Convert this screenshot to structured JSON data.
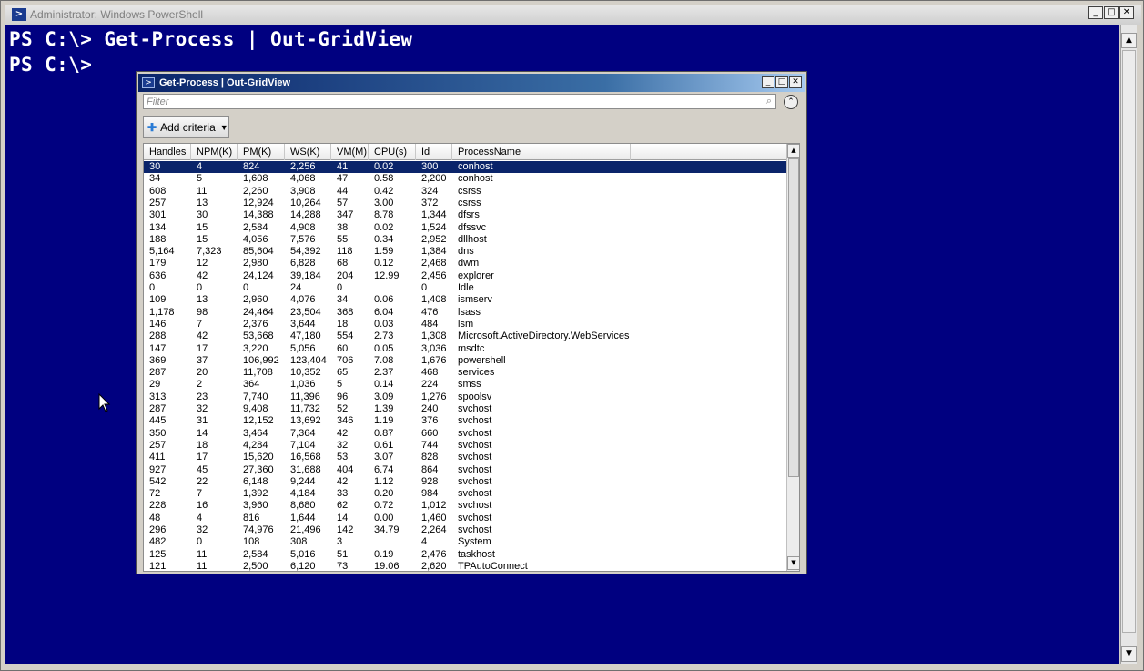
{
  "ps_window": {
    "title": "Administrator: Windows PowerShell",
    "console_lines": [
      "PS C:\\> Get-Process | Out-GridView",
      "PS C:\\>"
    ]
  },
  "gridview": {
    "title": "Get-Process | Out-GridView",
    "filter_placeholder": "Filter",
    "add_criteria_label": "Add criteria",
    "columns": [
      "Handles",
      "NPM(K)",
      "PM(K)",
      "WS(K)",
      "VM(M)",
      "CPU(s)",
      "Id",
      "ProcessName"
    ],
    "rows": [
      [
        "30",
        "4",
        "824",
        "2,256",
        "41",
        "0.02",
        "300",
        "conhost"
      ],
      [
        "34",
        "5",
        "1,608",
        "4,068",
        "47",
        "0.58",
        "2,200",
        "conhost"
      ],
      [
        "608",
        "11",
        "2,260",
        "3,908",
        "44",
        "0.42",
        "324",
        "csrss"
      ],
      [
        "257",
        "13",
        "12,924",
        "10,264",
        "57",
        "3.00",
        "372",
        "csrss"
      ],
      [
        "301",
        "30",
        "14,388",
        "14,288",
        "347",
        "8.78",
        "1,344",
        "dfsrs"
      ],
      [
        "134",
        "15",
        "2,584",
        "4,908",
        "38",
        "0.02",
        "1,524",
        "dfssvc"
      ],
      [
        "188",
        "15",
        "4,056",
        "7,576",
        "55",
        "0.34",
        "2,952",
        "dllhost"
      ],
      [
        "5,164",
        "7,323",
        "85,604",
        "54,392",
        "118",
        "1.59",
        "1,384",
        "dns"
      ],
      [
        "179",
        "12",
        "2,980",
        "6,828",
        "68",
        "0.12",
        "2,468",
        "dwm"
      ],
      [
        "636",
        "42",
        "24,124",
        "39,184",
        "204",
        "12.99",
        "2,456",
        "explorer"
      ],
      [
        "0",
        "0",
        "0",
        "24",
        "0",
        "",
        "0",
        "Idle"
      ],
      [
        "109",
        "13",
        "2,960",
        "4,076",
        "34",
        "0.06",
        "1,408",
        "ismserv"
      ],
      [
        "1,178",
        "98",
        "24,464",
        "23,504",
        "368",
        "6.04",
        "476",
        "lsass"
      ],
      [
        "146",
        "7",
        "2,376",
        "3,644",
        "18",
        "0.03",
        "484",
        "lsm"
      ],
      [
        "288",
        "42",
        "53,668",
        "47,180",
        "554",
        "2.73",
        "1,308",
        "Microsoft.ActiveDirectory.WebServices"
      ],
      [
        "147",
        "17",
        "3,220",
        "5,056",
        "60",
        "0.05",
        "3,036",
        "msdtc"
      ],
      [
        "369",
        "37",
        "106,992",
        "123,404",
        "706",
        "7.08",
        "1,676",
        "powershell"
      ],
      [
        "287",
        "20",
        "11,708",
        "10,352",
        "65",
        "2.37",
        "468",
        "services"
      ],
      [
        "29",
        "2",
        "364",
        "1,036",
        "5",
        "0.14",
        "224",
        "smss"
      ],
      [
        "313",
        "23",
        "7,740",
        "11,396",
        "96",
        "3.09",
        "1,276",
        "spoolsv"
      ],
      [
        "287",
        "32",
        "9,408",
        "11,732",
        "52",
        "1.39",
        "240",
        "svchost"
      ],
      [
        "445",
        "31",
        "12,152",
        "13,692",
        "346",
        "1.19",
        "376",
        "svchost"
      ],
      [
        "350",
        "14",
        "3,464",
        "7,364",
        "42",
        "0.87",
        "660",
        "svchost"
      ],
      [
        "257",
        "18",
        "4,284",
        "7,104",
        "32",
        "0.61",
        "744",
        "svchost"
      ],
      [
        "411",
        "17",
        "15,620",
        "16,568",
        "53",
        "3.07",
        "828",
        "svchost"
      ],
      [
        "927",
        "45",
        "27,360",
        "31,688",
        "404",
        "6.74",
        "864",
        "svchost"
      ],
      [
        "542",
        "22",
        "6,148",
        "9,244",
        "42",
        "1.12",
        "928",
        "svchost"
      ],
      [
        "72",
        "7",
        "1,392",
        "4,184",
        "33",
        "0.20",
        "984",
        "svchost"
      ],
      [
        "228",
        "16",
        "3,960",
        "8,680",
        "62",
        "0.72",
        "1,012",
        "svchost"
      ],
      [
        "48",
        "4",
        "816",
        "1,644",
        "14",
        "0.00",
        "1,460",
        "svchost"
      ],
      [
        "296",
        "32",
        "74,976",
        "21,496",
        "142",
        "34.79",
        "2,264",
        "svchost"
      ],
      [
        "482",
        "0",
        "108",
        "308",
        "3",
        "",
        "4",
        "System"
      ],
      [
        "125",
        "11",
        "2,584",
        "5,016",
        "51",
        "0.19",
        "2,476",
        "taskhost"
      ],
      [
        "121",
        "11",
        "2,500",
        "6,120",
        "73",
        "19.06",
        "2,620",
        "TPAutoConnect"
      ]
    ],
    "selected_row": 0
  },
  "icons": {
    "ps_app": "powershell-icon",
    "minimize": "minimize-icon",
    "maximize": "maximize-icon",
    "close": "close-icon",
    "search": "search-icon",
    "collapse": "collapse-up-icon",
    "add": "plus-icon",
    "dropdown": "chevron-down-icon",
    "cursor": "mouse-pointer-icon"
  },
  "colors": {
    "console_bg": "#000080",
    "selection_bg": "#0a246a"
  }
}
